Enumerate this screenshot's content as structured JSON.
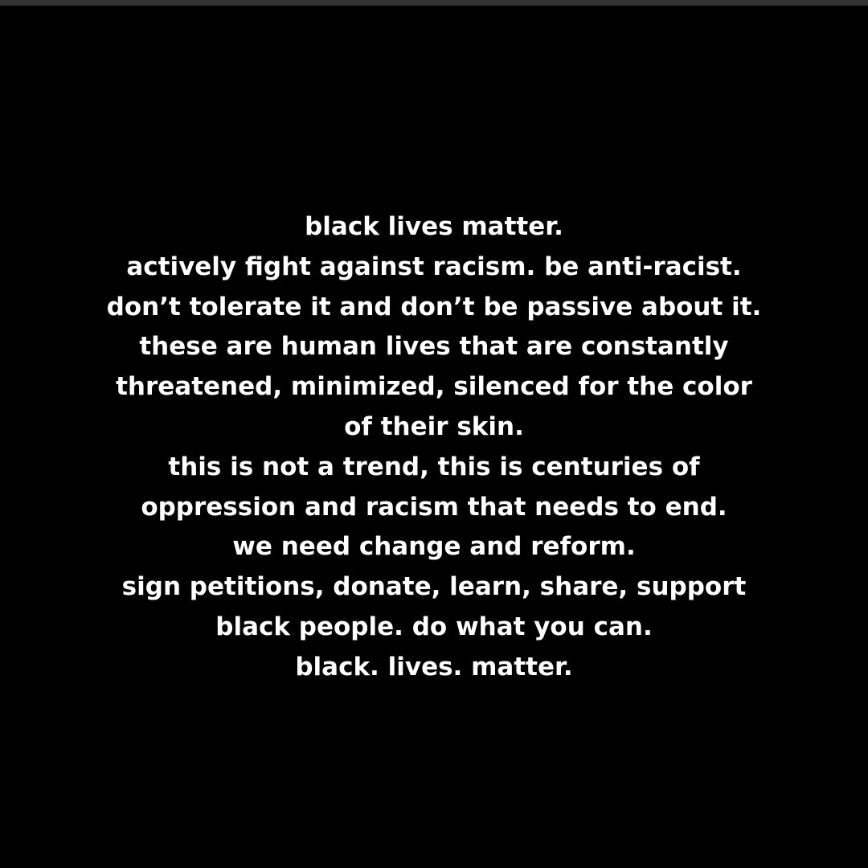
{
  "colors": {
    "background": "#000000",
    "text": "#ffffff",
    "top_bar": "#333333"
  },
  "message": {
    "lines": [
      "black lives matter.",
      "actively fight against racism. be anti-racist.",
      "don’t tolerate it and don’t be passive about it.",
      "these are human lives that are constantly",
      "threatened, minimized, silenced for the color",
      "of their skin.",
      "this is not a trend, this is centuries of",
      "oppression and racism that needs to end.",
      "we need change and reform.",
      "sign petitions, donate, learn, share, support",
      "black people. do what you can.",
      "black. lives. matter."
    ]
  }
}
